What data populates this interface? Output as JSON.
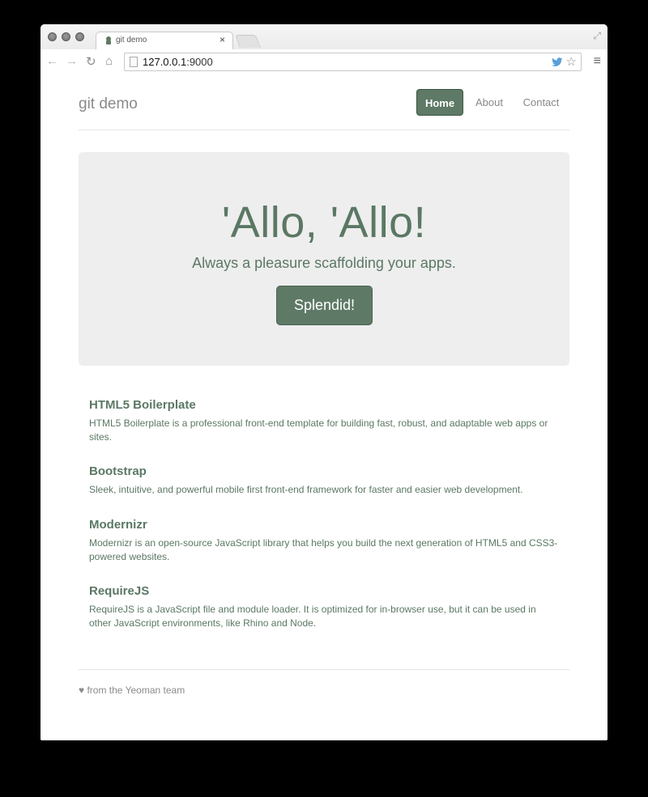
{
  "browser": {
    "tab_title": "git demo",
    "tab_close": "×",
    "url_host": "127.0.0.1",
    "url_port": ":9000",
    "icons": {
      "back": "←",
      "forward": "→",
      "reload": "↻",
      "home": "⌂",
      "star": "☆",
      "menu": "≡",
      "fullscreen": "⤢",
      "twitter": "🐦"
    }
  },
  "header": {
    "brand": "git demo",
    "nav": [
      {
        "label": "Home",
        "active": true
      },
      {
        "label": "About",
        "active": false
      },
      {
        "label": "Contact",
        "active": false
      }
    ]
  },
  "jumbotron": {
    "title": "'Allo, 'Allo!",
    "lead": "Always a pleasure scaffolding your apps.",
    "button": "Splendid!"
  },
  "features": [
    {
      "title": "HTML5 Boilerplate",
      "text": "HTML5 Boilerplate is a professional front-end template for building fast, robust, and adaptable web apps or sites."
    },
    {
      "title": "Bootstrap",
      "text": "Sleek, intuitive, and powerful mobile first front-end framework for faster and easier web development."
    },
    {
      "title": "Modernizr",
      "text": "Modernizr is an open-source JavaScript library that helps you build the next generation of HTML5 and CSS3-powered websites."
    },
    {
      "title": "RequireJS",
      "text": "RequireJS is a JavaScript file and module loader. It is optimized for in-browser use, but it can be used in other JavaScript environments, like Rhino and Node."
    }
  ],
  "footer": {
    "text": "♥ from the Yeoman team"
  },
  "colors": {
    "accent": "#5e7a66",
    "text": "#5b7864",
    "jumbotron_bg": "#eeeeee",
    "muted": "#8a8a8a"
  }
}
